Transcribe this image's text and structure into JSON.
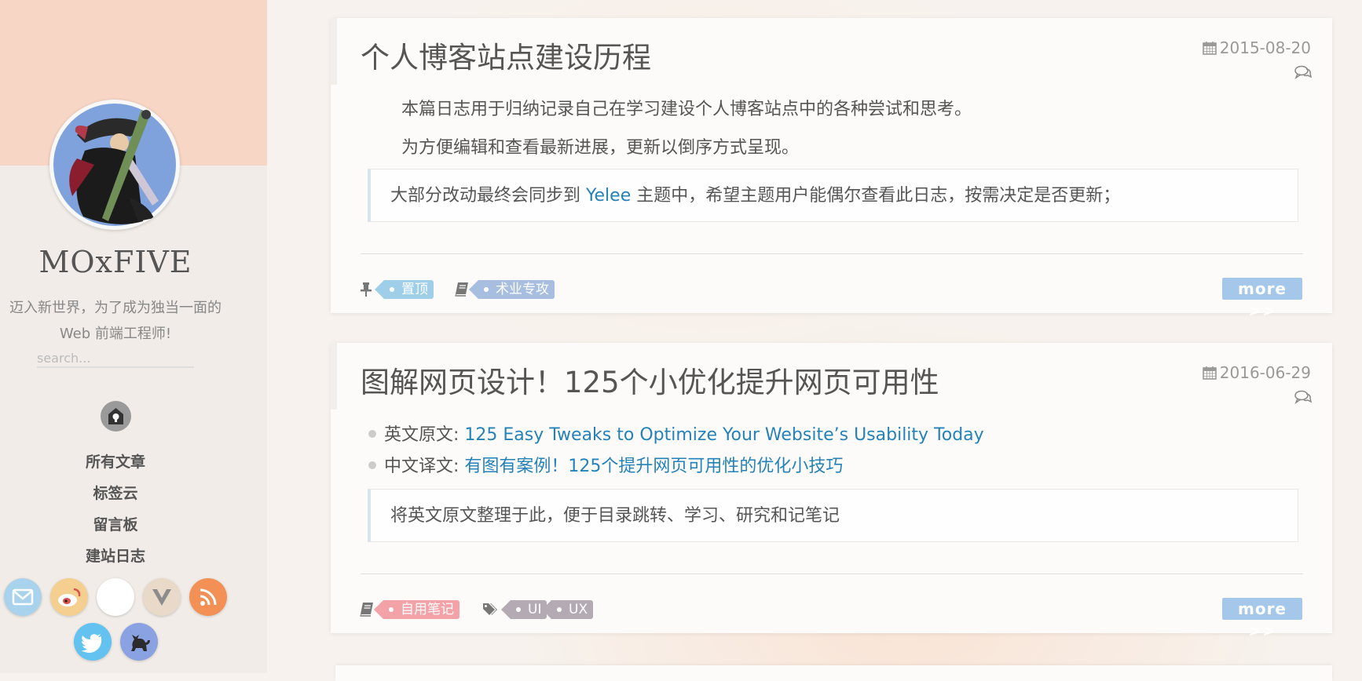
{
  "sidebar": {
    "site_title": "MOxFIVE",
    "subtitle_line1": "迈入新世界，为了成为独当一面的",
    "subtitle_line2": "Web 前端工程师!",
    "search_placeholder": "search...",
    "nav": [
      {
        "label": "所有文章"
      },
      {
        "label": "标签云"
      },
      {
        "label": "留言板"
      },
      {
        "label": "建站日志"
      }
    ],
    "social": [
      {
        "icon": "mail-icon",
        "color": "#a9d3ec"
      },
      {
        "icon": "weibo-icon",
        "color": "#f4cf8f"
      },
      {
        "icon": "github-icon",
        "color": "#ffffff"
      },
      {
        "icon": "vue-icon",
        "color": "#e8d9c8"
      },
      {
        "icon": "rss-icon",
        "color": "#f29055"
      },
      {
        "icon": "twitter-icon",
        "color": "#63c2ef"
      },
      {
        "icon": "cat-icon",
        "color": "#8aa1e2"
      }
    ]
  },
  "posts": [
    {
      "title": "个人博客站点建设历程",
      "date": "2015-08-20",
      "paragraphs": [
        "本篇日志用于归纳记录自己在学习建设个人博客站点中的各种尝试和思考。",
        "为方便编辑和查看最新进展，更新以倒序方式呈现。"
      ],
      "quote": {
        "before": "大部分改动最终会同步到 ",
        "link": "Yelee",
        "after": " 主题中，希望主题用户能偶尔查看此日志，按需决定是否更新；"
      },
      "tags_group1": [
        "置顶"
      ],
      "tags_group2": [
        "术业专攻"
      ],
      "more_label": "more >>"
    },
    {
      "title": "图解网页设计！125个小优化提升网页可用性",
      "date": "2016-06-29",
      "bullets": [
        {
          "label": "英文原文: ",
          "link": "125 Easy Tweaks to Optimize Your Website’s Usability Today"
        },
        {
          "label": "中文译文: ",
          "link": "有图有案例！125个提升网页可用性的优化小技巧"
        }
      ],
      "quote": "将英文原文整理于此，便于目录跳转、学习、研究和记笔记",
      "tags_group1": [
        "自用笔记"
      ],
      "tags_group2": [
        "UI",
        "UX"
      ],
      "more_label": "more >>"
    }
  ],
  "colors": {
    "link": "#2482b8",
    "more_button": "#a5c8ea",
    "tag_blue": "#9fcfe8",
    "tag_violet": "#a7bee0",
    "tag_pink": "#f3a2a7",
    "tag_gray": "#b4aab3"
  }
}
